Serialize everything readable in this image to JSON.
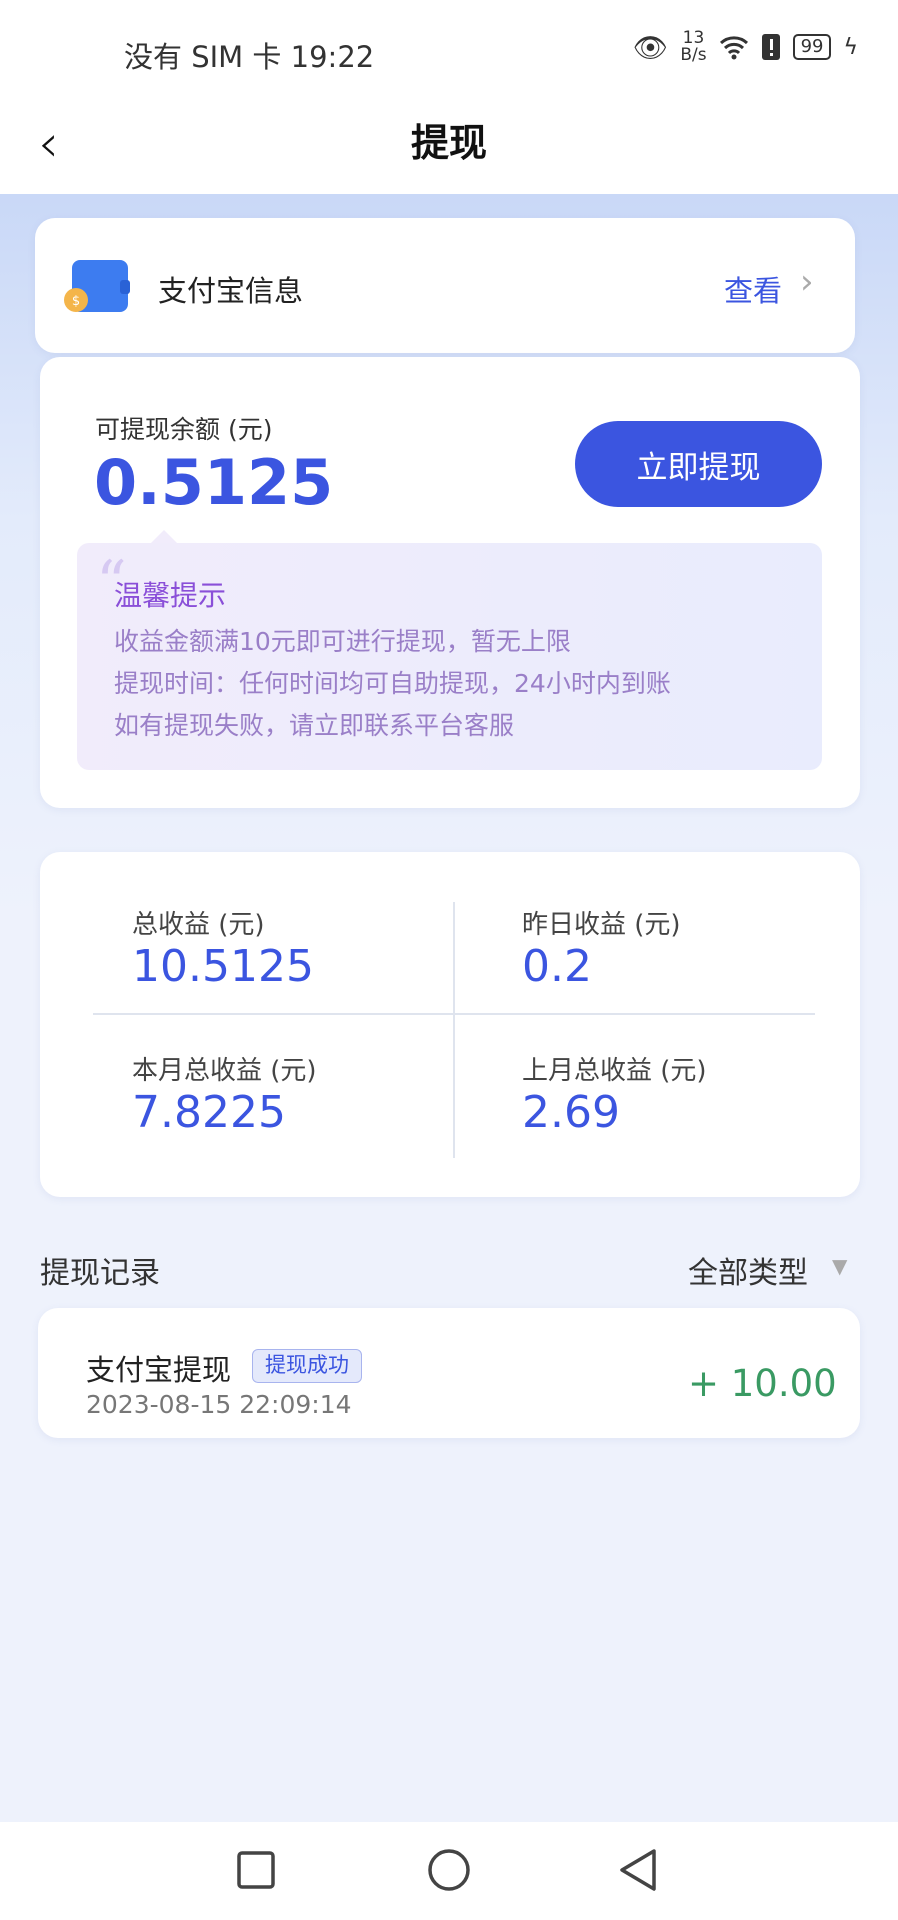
{
  "status_bar": {
    "carrier": "没有 SIM 卡",
    "time": "19:22",
    "net_speed_value": "13",
    "net_speed_unit": "B/s",
    "battery": "99"
  },
  "header": {
    "title": "提现"
  },
  "alipay": {
    "label": "支付宝信息",
    "view": "查看"
  },
  "balance": {
    "label": "可提现余额 (元)",
    "value": "0.5125",
    "button": "立即提现"
  },
  "tips": {
    "title": "温馨提示",
    "lines": [
      "收益金额满10元即可进行提现，暂无上限",
      "提现时间：任何时间均可自助提现，24小时内到账",
      "如有提现失败，请立即联系平台客服"
    ]
  },
  "stats": [
    {
      "label": "总收益 (元)",
      "value": "10.5125"
    },
    {
      "label": "昨日收益 (元)",
      "value": "0.2"
    },
    {
      "label": "本月总收益 (元)",
      "value": "7.8225"
    },
    {
      "label": "上月总收益 (元)",
      "value": "2.69"
    }
  ],
  "records": {
    "title": "提现记录",
    "filter": "全部类型",
    "items": [
      {
        "name": "支付宝提现",
        "status": "提现成功",
        "time": "2023-08-15 22:09:14",
        "amount": "+ 10.00"
      }
    ]
  },
  "colors": {
    "accent": "#3b55e0",
    "success": "#3a9a63",
    "tip": "#8a4fd8"
  }
}
